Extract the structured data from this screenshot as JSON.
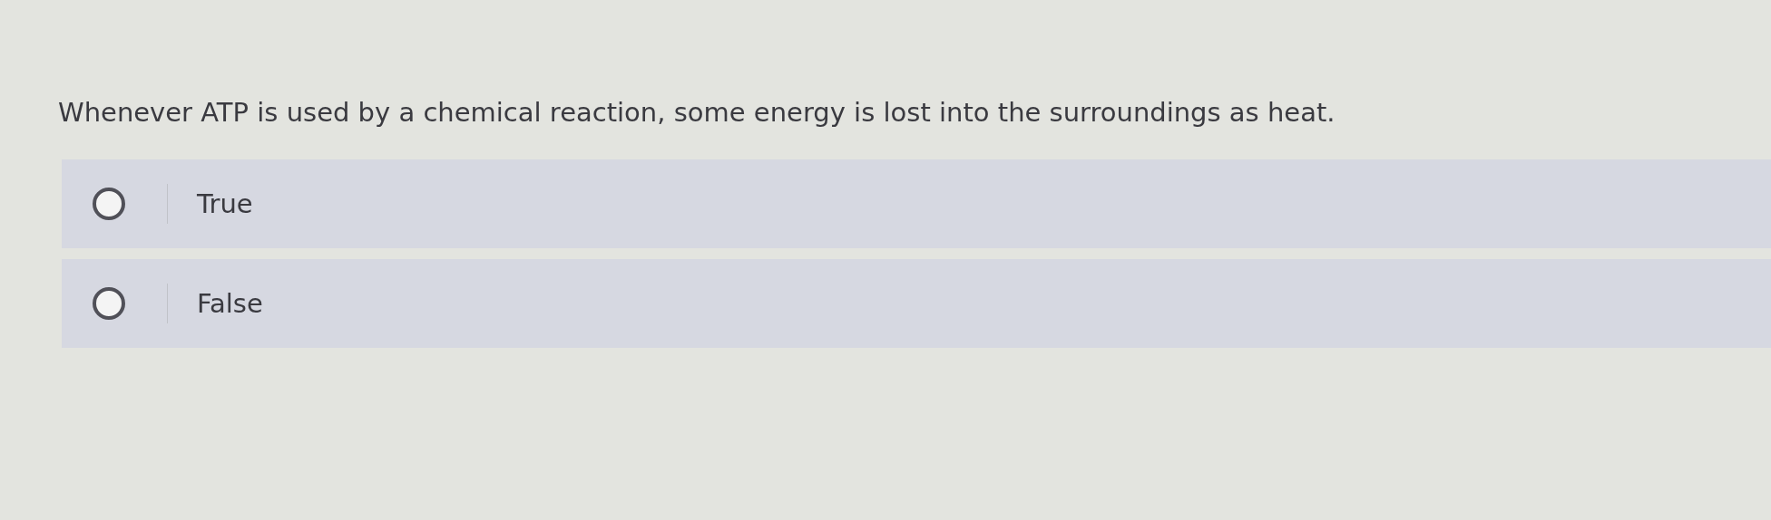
{
  "question": {
    "text": "Whenever ATP is used by a chemical reaction, some energy is lost into the surroundings as heat."
  },
  "options": [
    {
      "label": "True",
      "selected": false
    },
    {
      "label": "False",
      "selected": false
    }
  ]
}
